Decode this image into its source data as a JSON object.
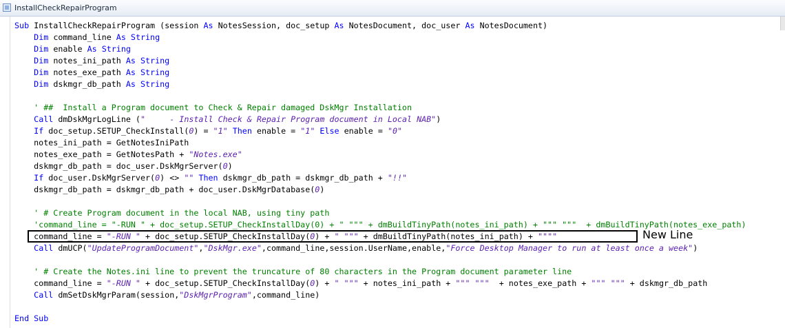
{
  "window": {
    "title": "InstallCheckRepairProgram"
  },
  "annotation": "New Line",
  "colors": {
    "keyword": "#0000ff",
    "string": "#5a1fb0",
    "comment": "#008000",
    "text": "#000000"
  },
  "code_lines": [
    [
      {
        "t": "Sub",
        "c": "kw"
      },
      {
        "t": " InstallCheckRepairProgram (session "
      },
      {
        "t": "As",
        "c": "kw"
      },
      {
        "t": " NotesSession, doc_setup "
      },
      {
        "t": "As",
        "c": "kw"
      },
      {
        "t": " NotesDocument, doc_user "
      },
      {
        "t": "As",
        "c": "kw"
      },
      {
        "t": " NotesDocument)"
      }
    ],
    [
      {
        "t": "    "
      },
      {
        "t": "Dim",
        "c": "kw"
      },
      {
        "t": " command_line "
      },
      {
        "t": "As String",
        "c": "kw"
      }
    ],
    [
      {
        "t": "    "
      },
      {
        "t": "Dim",
        "c": "kw"
      },
      {
        "t": " enable "
      },
      {
        "t": "As String",
        "c": "kw"
      }
    ],
    [
      {
        "t": "    "
      },
      {
        "t": "Dim",
        "c": "kw"
      },
      {
        "t": " notes_ini_path "
      },
      {
        "t": "As String",
        "c": "kw"
      }
    ],
    [
      {
        "t": "    "
      },
      {
        "t": "Dim",
        "c": "kw"
      },
      {
        "t": " notes_exe_path "
      },
      {
        "t": "As String",
        "c": "kw"
      }
    ],
    [
      {
        "t": "    "
      },
      {
        "t": "Dim",
        "c": "kw"
      },
      {
        "t": " dskmgr_db_path "
      },
      {
        "t": "As String",
        "c": "kw"
      }
    ],
    [],
    [
      {
        "t": "    ' ##  Install a Program document to Check & Repair damaged DskMgr Installation",
        "c": "cmt"
      }
    ],
    [
      {
        "t": "    "
      },
      {
        "t": "Call",
        "c": "kw"
      },
      {
        "t": " dmDskMgrLogLine ("
      },
      {
        "t": "\"     - Install Check & Repair Program document in Local NAB\"",
        "c": "str"
      },
      {
        "t": ")"
      }
    ],
    [
      {
        "t": "    "
      },
      {
        "t": "If",
        "c": "kw"
      },
      {
        "t": " doc_setup.SETUP_CheckInstall("
      },
      {
        "t": "0",
        "c": "str"
      },
      {
        "t": ") = "
      },
      {
        "t": "\"1\"",
        "c": "str"
      },
      {
        "t": " "
      },
      {
        "t": "Then",
        "c": "kw"
      },
      {
        "t": " enable = "
      },
      {
        "t": "\"1\"",
        "c": "str"
      },
      {
        "t": " "
      },
      {
        "t": "Else",
        "c": "kw"
      },
      {
        "t": " enable = "
      },
      {
        "t": "\"0\"",
        "c": "str"
      }
    ],
    [
      {
        "t": "    notes_ini_path = GetNotesIniPath"
      }
    ],
    [
      {
        "t": "    notes_exe_path = GetNotesPath + "
      },
      {
        "t": "\"Notes.exe\"",
        "c": "str"
      }
    ],
    [
      {
        "t": "    dskmgr_db_path = doc_user.DskMgrServer("
      },
      {
        "t": "0",
        "c": "str"
      },
      {
        "t": ")"
      }
    ],
    [
      {
        "t": "    "
      },
      {
        "t": "If",
        "c": "kw"
      },
      {
        "t": " doc_user.DskMgrServer("
      },
      {
        "t": "0",
        "c": "str"
      },
      {
        "t": ") <> "
      },
      {
        "t": "\"\"",
        "c": "str"
      },
      {
        "t": " "
      },
      {
        "t": "Then",
        "c": "kw"
      },
      {
        "t": " dskmgr_db_path = dskmgr_db_path + "
      },
      {
        "t": "\"!!\"",
        "c": "str"
      }
    ],
    [
      {
        "t": "    dskmgr_db_path = dskmgr_db_path + doc_user.DskMgrDatabase("
      },
      {
        "t": "0",
        "c": "str"
      },
      {
        "t": ")"
      }
    ],
    [],
    [
      {
        "t": "    ' # Create Program document in the local NAB, using tiny path",
        "c": "cmt"
      }
    ],
    [
      {
        "t": "    'command_line = \"-RUN \" + doc_setup.SETUP_CheckInstallDay(0) + \" \"\"\" + dmBuildTinyPath(notes_ini_path) + \"\"\" \"\"\"  + dmBuildTinyPath(notes_exe_path)",
        "c": "cmt"
      }
    ],
    [
      {
        "t": "    command_line = "
      },
      {
        "t": "\"-RUN \"",
        "c": "str"
      },
      {
        "t": " + doc_setup.SETUP_CheckInstallDay("
      },
      {
        "t": "0",
        "c": "str"
      },
      {
        "t": ") + "
      },
      {
        "t": "\" \"\"\"",
        "c": "str"
      },
      {
        "t": " + dmBuildTinyPath(notes_ini_path) + "
      },
      {
        "t": "\"\"\"\"",
        "c": "str"
      }
    ],
    [
      {
        "t": "    "
      },
      {
        "t": "Call",
        "c": "kw"
      },
      {
        "t": " dmUCP("
      },
      {
        "t": "\"UpdateProgramDocument\"",
        "c": "str"
      },
      {
        "t": ","
      },
      {
        "t": "\"DskMgr.exe\"",
        "c": "str"
      },
      {
        "t": ",command_line,session.UserName,enable,"
      },
      {
        "t": "\"Force Desktop Manager to run at least once a week\"",
        "c": "str"
      },
      {
        "t": ")"
      }
    ],
    [],
    [
      {
        "t": "    ' # Create the Notes.ini line to prevent the truncature of 80 characters in the Program document parameter line",
        "c": "cmt"
      }
    ],
    [
      {
        "t": "    command_line = "
      },
      {
        "t": "\"-RUN \"",
        "c": "str"
      },
      {
        "t": " + doc_setup.SETUP_CheckInstallDay("
      },
      {
        "t": "0",
        "c": "str"
      },
      {
        "t": ") + "
      },
      {
        "t": "\" \"\"\"",
        "c": "str"
      },
      {
        "t": " + notes_ini_path + "
      },
      {
        "t": "\"\"\" \"\"\"",
        "c": "str"
      },
      {
        "t": "  + notes_exe_path + "
      },
      {
        "t": "\"\"\" \"\"\"",
        "c": "str"
      },
      {
        "t": " + dskmgr_db_path"
      }
    ],
    [
      {
        "t": "    "
      },
      {
        "t": "Call",
        "c": "kw"
      },
      {
        "t": " dmSetDskMgrParam(session,"
      },
      {
        "t": "\"DskMgrProgram\"",
        "c": "str"
      },
      {
        "t": ",command_line)"
      }
    ],
    [],
    [
      {
        "t": "End Sub",
        "c": "kw"
      }
    ]
  ]
}
